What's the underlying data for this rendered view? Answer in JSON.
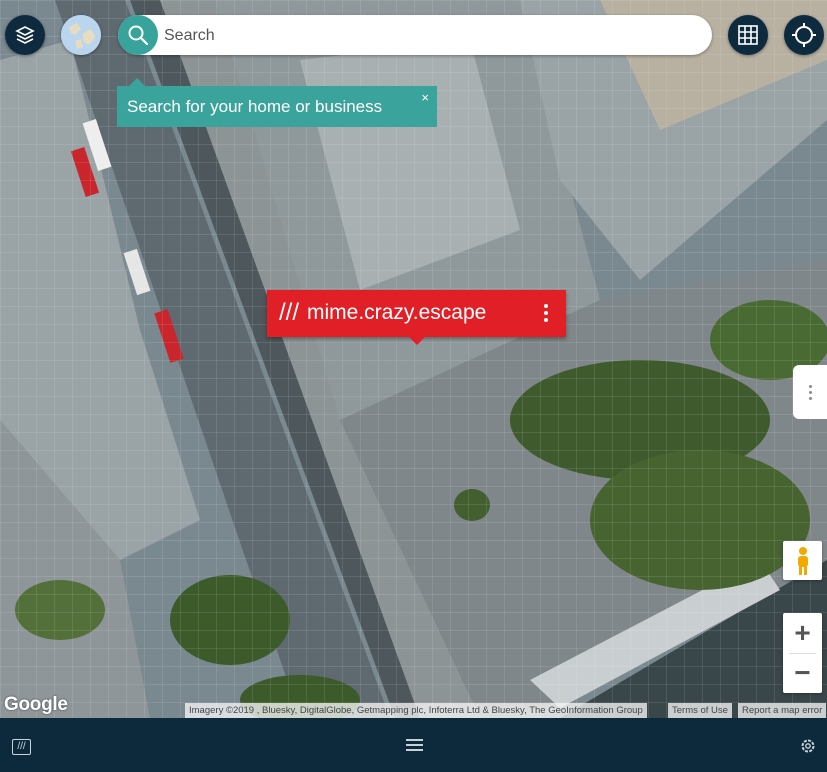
{
  "search": {
    "placeholder": "Search"
  },
  "tooltip": {
    "text": "Search for your home or business",
    "close": "×"
  },
  "marker": {
    "slashes": "///",
    "words": "mime.crazy.escape"
  },
  "map": {
    "provider_logo": "Google",
    "attribution": "Imagery ©2019 , Bluesky, DigitalGlobe, Getmapping plc, Infoterra Ltd & Bluesky, The GeoInformation Group",
    "terms": "Terms of Use",
    "report": "Report a map error",
    "zoom_in": "+",
    "zoom_out": "−"
  },
  "colors": {
    "teal": "#3aa39b",
    "navy": "#0d2a3d",
    "marker_red": "#e11f26"
  },
  "icons": {
    "layers": "layers-icon",
    "globe": "globe-icon",
    "search": "search-icon",
    "grid": "grid-icon",
    "locate": "crosshair-icon",
    "pegman": "pegman-icon",
    "settings": "gear-icon",
    "menu": "hamburger-icon",
    "logo": "slashes-logo-icon"
  },
  "bottombar": {
    "logo_text": "///"
  }
}
